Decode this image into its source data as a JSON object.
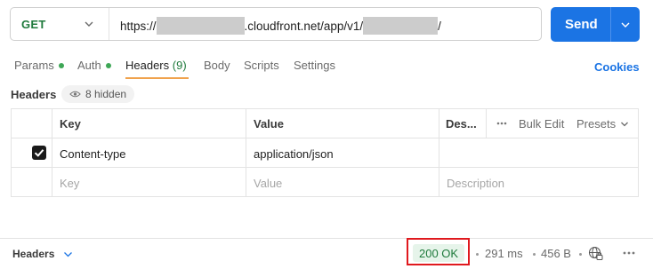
{
  "request": {
    "method": "GET",
    "url_prefix": "https://",
    "url_middle": ".cloudfront.net/app/v1/",
    "url_suffix": "/",
    "send_label": "Send"
  },
  "tabs": [
    {
      "label": "Params",
      "dot": true
    },
    {
      "label": "Auth",
      "dot": true
    },
    {
      "label": "Headers",
      "count": "(9)",
      "active": true
    },
    {
      "label": "Body"
    },
    {
      "label": "Scripts"
    },
    {
      "label": "Settings"
    }
  ],
  "cookies_label": "Cookies",
  "headers_section": {
    "title": "Headers",
    "hidden_label": "8 hidden"
  },
  "table": {
    "columns": {
      "key": "Key",
      "value": "Value",
      "description": "Des..."
    },
    "bulk_edit_label": "Bulk Edit",
    "presets_label": "Presets",
    "rows": [
      {
        "checked": true,
        "key": "Content-type",
        "value": "application/json",
        "description": ""
      }
    ],
    "placeholders": {
      "key": "Key",
      "value": "Value",
      "description": "Description"
    }
  },
  "footer": {
    "title": "Headers",
    "status": "200 OK",
    "time": "291 ms",
    "size": "456 B"
  },
  "colors": {
    "accent": "#1b74e4",
    "method_green": "#1f7a3c",
    "tab_underline": "#f0a24c",
    "status_bg": "#e6f4ea",
    "highlight_red": "#e0191e"
  }
}
